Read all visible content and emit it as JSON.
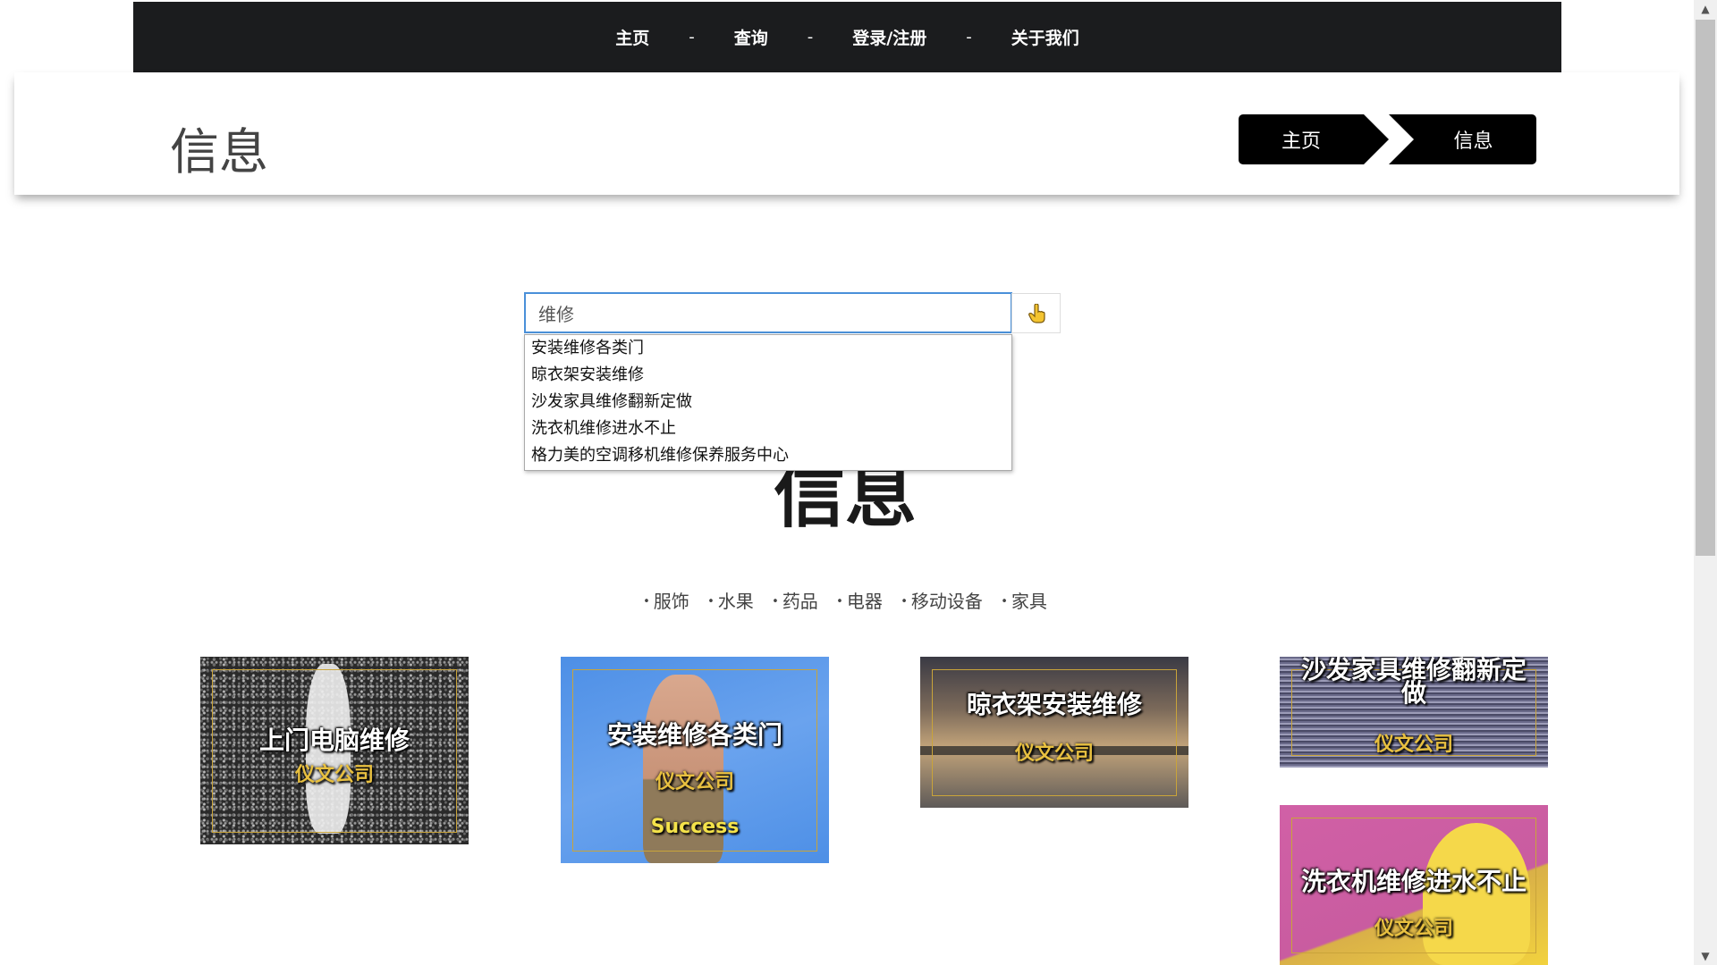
{
  "nav": {
    "items": [
      "主页",
      "查询",
      "登录/注册",
      "关于我们"
    ],
    "separator": "-"
  },
  "header": {
    "title": "信息",
    "breadcrumb": {
      "home": "主页",
      "current": "信息"
    }
  },
  "search": {
    "value": "维修",
    "button_icon": "hand-pointer-icon",
    "suggestions": [
      "安装维修各类门",
      "晾衣架安装维修",
      "沙发家具维修翻新定做",
      "洗衣机维修进水不止",
      "格力美的空调移机维修保养服务中心"
    ]
  },
  "section": {
    "heading": "信息",
    "categories": [
      "服饰",
      "水果",
      "药品",
      "电器",
      "移动设备",
      "家具"
    ]
  },
  "cards": [
    {
      "title": "上门电脑维修",
      "company": "仪文公司"
    },
    {
      "title": "安装维修各类门",
      "company": "仪文公司",
      "extra": "Success"
    },
    {
      "title": "晾衣架安装维修",
      "company": "仪文公司"
    },
    {
      "title": "沙发家具维修翻新定做",
      "company": "仪文公司"
    },
    {
      "title": "洗衣机维修进水不止",
      "company": "仪文公司"
    }
  ],
  "colors": {
    "nav_bg": "#1b1c1e",
    "search_border": "#4a90d9",
    "card_frame": "#c9a43a",
    "company_text": "#e8c040"
  }
}
